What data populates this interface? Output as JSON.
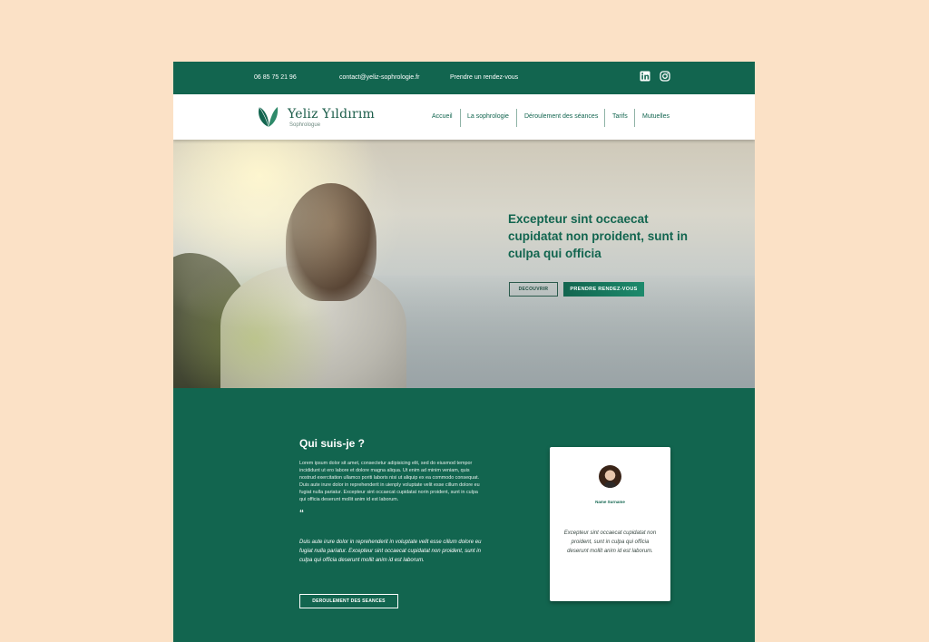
{
  "topbar": {
    "phone": "06 85 75 21 96",
    "email": "contact@yeliz-sophrologie.fr",
    "appointment": "Prendre un rendez-vous",
    "social": [
      "linkedin-icon",
      "instagram-icon"
    ]
  },
  "brand": {
    "name": "Yeliz Yıldırım",
    "subtitle": "Sophrologue"
  },
  "nav": {
    "items": [
      {
        "label": "Accueil"
      },
      {
        "label": "La sophrologie"
      },
      {
        "label": "Déroulement des séances"
      },
      {
        "label": "Tarifs"
      },
      {
        "label": "Mutuelles"
      }
    ]
  },
  "hero": {
    "title": "Excepteur sint occaecat cupidatat non proident, sunt in culpa qui officia",
    "btn_discover": "DECOUVRIR",
    "btn_appointment": "PRENDRE RENDEZ-VOUS"
  },
  "about": {
    "title": "Qui suis-je ?",
    "text": "Lorem ipsum dolor sit amet, consectetur adipisicing elit, sed do eiusmod tempor incididunt ut ero labore et dolore magna aliqua. Ut enim ad minim veniam, quis nostrud exercitation ullamco poriti laboris nisi ut aliquip ex ea commodo consequat. Duis aute irure dolor in reprehenderit in uienply voluptate velit esse cillum dolore eu fugiat nulla pariatur. Excepteur sint occaecat cupidatat norin proident, sunt in culpa qui officia deserunt mollit anim id est laborum.",
    "quote_mark": "“",
    "quote": "Duis aute irure dolor in reprehenderit in voluptate velit esse cillum dolore eu fugiat nulla pariatur. Excepteur sint occaecat cupidatat non proident, sunt in culpa qui officia deserunt mollit anim id est laborum.",
    "btn_seances": "DEROULEMENT DES SEANCES"
  },
  "card": {
    "name": "Name Surname",
    "quote": "Excepteur sint occaecat cupidatat non proident, sunt in culpa qui officia deserunt mollit anim id est laborum."
  },
  "colors": {
    "brand_green": "#12654f",
    "page_background": "#fbe1c6",
    "white": "#ffffff"
  }
}
